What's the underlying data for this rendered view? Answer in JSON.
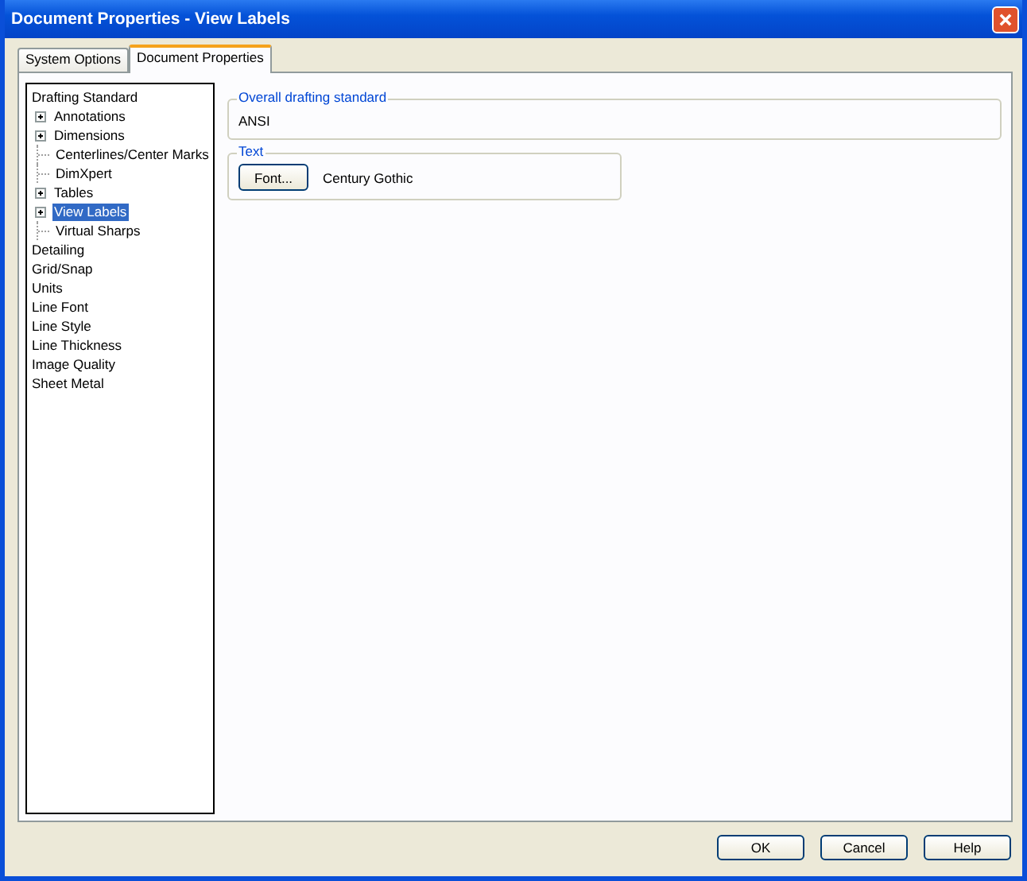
{
  "window": {
    "title": "Document Properties - View Labels"
  },
  "tabs": [
    {
      "label": "System Options",
      "selected": false
    },
    {
      "label": "Document Properties",
      "selected": true
    }
  ],
  "tree": [
    {
      "label": "Drafting Standard",
      "kind": "parent",
      "selected": false,
      "children": [
        {
          "label": "Annotations",
          "kind": "collapsed",
          "selected": false
        },
        {
          "label": "Dimensions",
          "kind": "collapsed",
          "selected": false
        },
        {
          "label": "Centerlines/Center Marks",
          "kind": "leaf",
          "selected": false
        },
        {
          "label": "DimXpert",
          "kind": "leaf",
          "selected": false
        },
        {
          "label": "Tables",
          "kind": "collapsed",
          "selected": false
        },
        {
          "label": "View Labels",
          "kind": "collapsed",
          "selected": true
        },
        {
          "label": "Virtual Sharps",
          "kind": "leaf",
          "selected": false
        }
      ]
    },
    {
      "label": "Detailing",
      "kind": "leaf",
      "selected": false
    },
    {
      "label": "Grid/Snap",
      "kind": "leaf",
      "selected": false
    },
    {
      "label": "Units",
      "kind": "leaf",
      "selected": false
    },
    {
      "label": "Line Font",
      "kind": "leaf",
      "selected": false
    },
    {
      "label": "Line Style",
      "kind": "leaf",
      "selected": false
    },
    {
      "label": "Line Thickness",
      "kind": "leaf",
      "selected": false
    },
    {
      "label": "Image Quality",
      "kind": "leaf",
      "selected": false
    },
    {
      "label": "Sheet Metal",
      "kind": "leaf",
      "selected": false
    }
  ],
  "groups": [
    {
      "title": "Overall drafting standard",
      "value": "ANSI"
    },
    {
      "title": "Text",
      "button": "Font...",
      "value": "Century Gothic"
    }
  ],
  "buttons": [
    "OK",
    "Cancel",
    "Help"
  ]
}
